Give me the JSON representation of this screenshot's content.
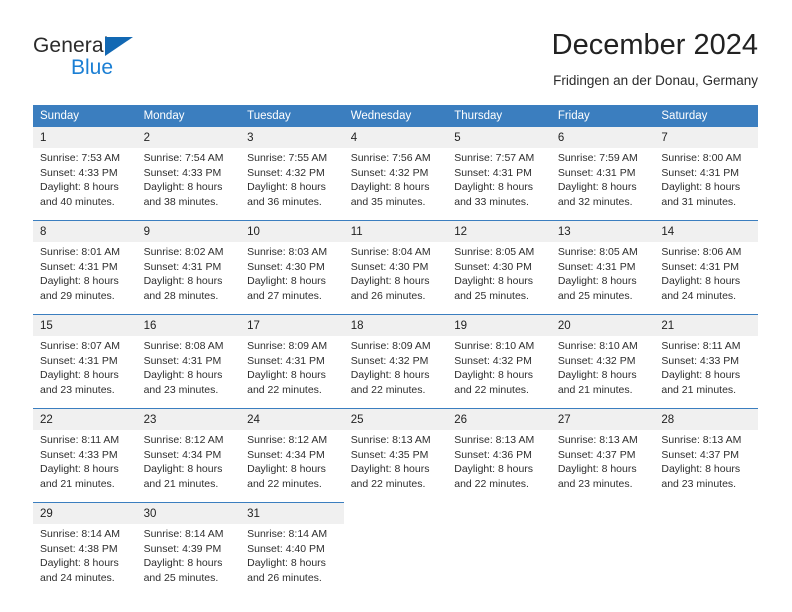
{
  "logo": {
    "word_one": "General",
    "word_two": "Blue",
    "triangle_color": "#1268b3",
    "blue_text_color": "#1b7fd4"
  },
  "header": {
    "title": "December 2024",
    "subtitle": "Fridingen an der Donau, Germany"
  },
  "theme": {
    "header_bg": "#3b7ebf",
    "header_text": "#ffffff",
    "daynum_bg": "#f0f0f0",
    "cell_bg": "#ffffff",
    "body_text": "#2e2e2e"
  },
  "weekday_headers": [
    "Sunday",
    "Monday",
    "Tuesday",
    "Wednesday",
    "Thursday",
    "Friday",
    "Saturday"
  ],
  "weeks": [
    {
      "days": [
        {
          "num": "1",
          "sunrise": "Sunrise: 7:53 AM",
          "sunset": "Sunset: 4:33 PM",
          "daylight_1": "Daylight: 8 hours",
          "daylight_2": "and 40 minutes."
        },
        {
          "num": "2",
          "sunrise": "Sunrise: 7:54 AM",
          "sunset": "Sunset: 4:33 PM",
          "daylight_1": "Daylight: 8 hours",
          "daylight_2": "and 38 minutes."
        },
        {
          "num": "3",
          "sunrise": "Sunrise: 7:55 AM",
          "sunset": "Sunset: 4:32 PM",
          "daylight_1": "Daylight: 8 hours",
          "daylight_2": "and 36 minutes."
        },
        {
          "num": "4",
          "sunrise": "Sunrise: 7:56 AM",
          "sunset": "Sunset: 4:32 PM",
          "daylight_1": "Daylight: 8 hours",
          "daylight_2": "and 35 minutes."
        },
        {
          "num": "5",
          "sunrise": "Sunrise: 7:57 AM",
          "sunset": "Sunset: 4:31 PM",
          "daylight_1": "Daylight: 8 hours",
          "daylight_2": "and 33 minutes."
        },
        {
          "num": "6",
          "sunrise": "Sunrise: 7:59 AM",
          "sunset": "Sunset: 4:31 PM",
          "daylight_1": "Daylight: 8 hours",
          "daylight_2": "and 32 minutes."
        },
        {
          "num": "7",
          "sunrise": "Sunrise: 8:00 AM",
          "sunset": "Sunset: 4:31 PM",
          "daylight_1": "Daylight: 8 hours",
          "daylight_2": "and 31 minutes."
        }
      ]
    },
    {
      "days": [
        {
          "num": "8",
          "sunrise": "Sunrise: 8:01 AM",
          "sunset": "Sunset: 4:31 PM",
          "daylight_1": "Daylight: 8 hours",
          "daylight_2": "and 29 minutes."
        },
        {
          "num": "9",
          "sunrise": "Sunrise: 8:02 AM",
          "sunset": "Sunset: 4:31 PM",
          "daylight_1": "Daylight: 8 hours",
          "daylight_2": "and 28 minutes."
        },
        {
          "num": "10",
          "sunrise": "Sunrise: 8:03 AM",
          "sunset": "Sunset: 4:30 PM",
          "daylight_1": "Daylight: 8 hours",
          "daylight_2": "and 27 minutes."
        },
        {
          "num": "11",
          "sunrise": "Sunrise: 8:04 AM",
          "sunset": "Sunset: 4:30 PM",
          "daylight_1": "Daylight: 8 hours",
          "daylight_2": "and 26 minutes."
        },
        {
          "num": "12",
          "sunrise": "Sunrise: 8:05 AM",
          "sunset": "Sunset: 4:30 PM",
          "daylight_1": "Daylight: 8 hours",
          "daylight_2": "and 25 minutes."
        },
        {
          "num": "13",
          "sunrise": "Sunrise: 8:05 AM",
          "sunset": "Sunset: 4:31 PM",
          "daylight_1": "Daylight: 8 hours",
          "daylight_2": "and 25 minutes."
        },
        {
          "num": "14",
          "sunrise": "Sunrise: 8:06 AM",
          "sunset": "Sunset: 4:31 PM",
          "daylight_1": "Daylight: 8 hours",
          "daylight_2": "and 24 minutes."
        }
      ]
    },
    {
      "days": [
        {
          "num": "15",
          "sunrise": "Sunrise: 8:07 AM",
          "sunset": "Sunset: 4:31 PM",
          "daylight_1": "Daylight: 8 hours",
          "daylight_2": "and 23 minutes."
        },
        {
          "num": "16",
          "sunrise": "Sunrise: 8:08 AM",
          "sunset": "Sunset: 4:31 PM",
          "daylight_1": "Daylight: 8 hours",
          "daylight_2": "and 23 minutes."
        },
        {
          "num": "17",
          "sunrise": "Sunrise: 8:09 AM",
          "sunset": "Sunset: 4:31 PM",
          "daylight_1": "Daylight: 8 hours",
          "daylight_2": "and 22 minutes."
        },
        {
          "num": "18",
          "sunrise": "Sunrise: 8:09 AM",
          "sunset": "Sunset: 4:32 PM",
          "daylight_1": "Daylight: 8 hours",
          "daylight_2": "and 22 minutes."
        },
        {
          "num": "19",
          "sunrise": "Sunrise: 8:10 AM",
          "sunset": "Sunset: 4:32 PM",
          "daylight_1": "Daylight: 8 hours",
          "daylight_2": "and 22 minutes."
        },
        {
          "num": "20",
          "sunrise": "Sunrise: 8:10 AM",
          "sunset": "Sunset: 4:32 PM",
          "daylight_1": "Daylight: 8 hours",
          "daylight_2": "and 21 minutes."
        },
        {
          "num": "21",
          "sunrise": "Sunrise: 8:11 AM",
          "sunset": "Sunset: 4:33 PM",
          "daylight_1": "Daylight: 8 hours",
          "daylight_2": "and 21 minutes."
        }
      ]
    },
    {
      "days": [
        {
          "num": "22",
          "sunrise": "Sunrise: 8:11 AM",
          "sunset": "Sunset: 4:33 PM",
          "daylight_1": "Daylight: 8 hours",
          "daylight_2": "and 21 minutes."
        },
        {
          "num": "23",
          "sunrise": "Sunrise: 8:12 AM",
          "sunset": "Sunset: 4:34 PM",
          "daylight_1": "Daylight: 8 hours",
          "daylight_2": "and 21 minutes."
        },
        {
          "num": "24",
          "sunrise": "Sunrise: 8:12 AM",
          "sunset": "Sunset: 4:34 PM",
          "daylight_1": "Daylight: 8 hours",
          "daylight_2": "and 22 minutes."
        },
        {
          "num": "25",
          "sunrise": "Sunrise: 8:13 AM",
          "sunset": "Sunset: 4:35 PM",
          "daylight_1": "Daylight: 8 hours",
          "daylight_2": "and 22 minutes."
        },
        {
          "num": "26",
          "sunrise": "Sunrise: 8:13 AM",
          "sunset": "Sunset: 4:36 PM",
          "daylight_1": "Daylight: 8 hours",
          "daylight_2": "and 22 minutes."
        },
        {
          "num": "27",
          "sunrise": "Sunrise: 8:13 AM",
          "sunset": "Sunset: 4:37 PM",
          "daylight_1": "Daylight: 8 hours",
          "daylight_2": "and 23 minutes."
        },
        {
          "num": "28",
          "sunrise": "Sunrise: 8:13 AM",
          "sunset": "Sunset: 4:37 PM",
          "daylight_1": "Daylight: 8 hours",
          "daylight_2": "and 23 minutes."
        }
      ]
    },
    {
      "days": [
        {
          "num": "29",
          "sunrise": "Sunrise: 8:14 AM",
          "sunset": "Sunset: 4:38 PM",
          "daylight_1": "Daylight: 8 hours",
          "daylight_2": "and 24 minutes."
        },
        {
          "num": "30",
          "sunrise": "Sunrise: 8:14 AM",
          "sunset": "Sunset: 4:39 PM",
          "daylight_1": "Daylight: 8 hours",
          "daylight_2": "and 25 minutes."
        },
        {
          "num": "31",
          "sunrise": "Sunrise: 8:14 AM",
          "sunset": "Sunset: 4:40 PM",
          "daylight_1": "Daylight: 8 hours",
          "daylight_2": "and 26 minutes."
        },
        {
          "num": "",
          "sunrise": "",
          "sunset": "",
          "daylight_1": "",
          "daylight_2": ""
        },
        {
          "num": "",
          "sunrise": "",
          "sunset": "",
          "daylight_1": "",
          "daylight_2": ""
        },
        {
          "num": "",
          "sunrise": "",
          "sunset": "",
          "daylight_1": "",
          "daylight_2": ""
        },
        {
          "num": "",
          "sunrise": "",
          "sunset": "",
          "daylight_1": "",
          "daylight_2": ""
        }
      ]
    }
  ]
}
